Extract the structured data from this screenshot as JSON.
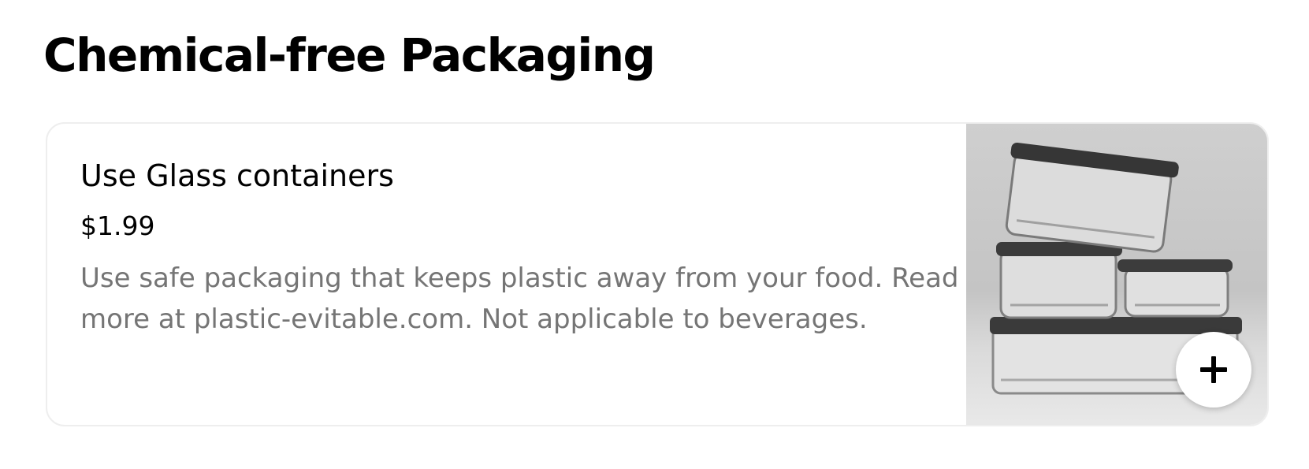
{
  "section": {
    "title": "Chemical-free Packaging"
  },
  "item": {
    "name": "Use Glass containers",
    "price": "$1.99",
    "description": "Use safe packaging that keeps plastic away from your food. Read more at plastic-evitable.com. Not applicable to beverages.",
    "image_icon": "glass-containers-photo",
    "add_icon": "plus-icon"
  },
  "colors": {
    "title": "#000000",
    "description": "#757575",
    "card_border": "#eeeeee",
    "add_button_bg": "#ffffff"
  }
}
